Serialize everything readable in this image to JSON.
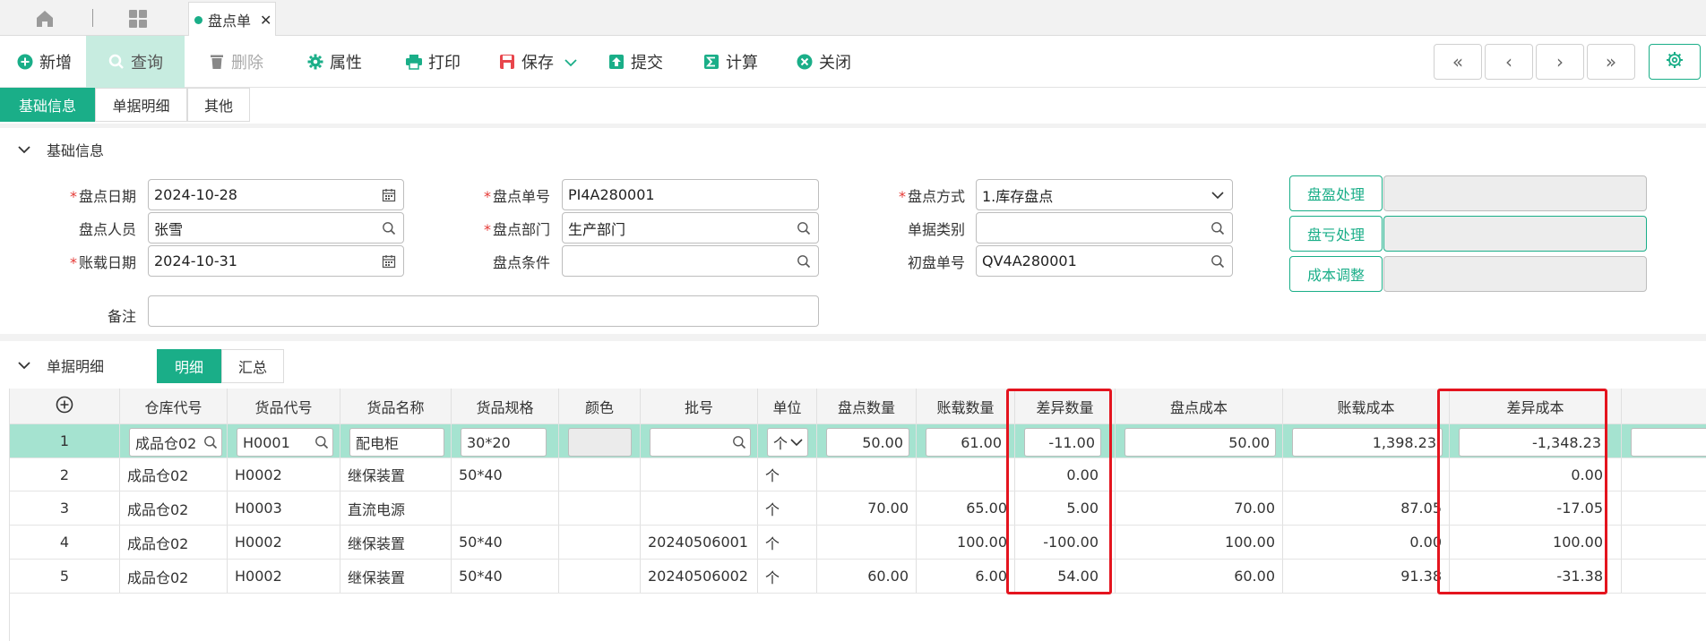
{
  "tabstrip": {
    "tab_label": "盘点单"
  },
  "toolbar": {
    "new": "新增",
    "query": "查询",
    "delete": "删除",
    "props": "属性",
    "print": "打印",
    "save": "保存",
    "submit": "提交",
    "calc": "计算",
    "close": "关闭",
    "nav": [
      "«",
      "‹",
      "›",
      "»"
    ]
  },
  "section_tabs": [
    "基础信息",
    "单据明细",
    "其他"
  ],
  "basic_section_title": "基础信息",
  "form": {
    "date_label": "盘点日期",
    "date": "2024-10-28",
    "no_label": "盘点单号",
    "no": "PI4A280001",
    "method_label": "盘点方式",
    "method": "1.库存盘点",
    "person_label": "盘点人员",
    "person": "张雪",
    "dept_label": "盘点部门",
    "dept": "生产部门",
    "doctype_label": "单据类别",
    "doctype": "",
    "acct_date_label": "账载日期",
    "acct_date": "2024-10-31",
    "cond_label": "盘点条件",
    "cond": "",
    "init_no_label": "初盘单号",
    "init_no": "QV4A280001",
    "remark_label": "备注",
    "remark": "",
    "btn_profit": "盘盈处理",
    "btn_loss": "盘亏处理",
    "btn_cost": "成本调整"
  },
  "detail_section_title": "单据明细",
  "detail_tabs": [
    "明细",
    "汇总"
  ],
  "table": {
    "headers": [
      "仓库代号",
      "货品代号",
      "货品名称",
      "货品规格",
      "颜色",
      "批号",
      "单位",
      "盘点数量",
      "账载数量",
      "差异数量",
      "盘点成本",
      "账载成本",
      "差异成本"
    ],
    "rows": [
      [
        "1",
        "成品仓02",
        "H0001",
        "配电柜",
        "30*20",
        "",
        "",
        "个",
        "50.00",
        "61.00",
        "-11.00",
        "50.00",
        "1,398.23",
        "-1,348.23"
      ],
      [
        "2",
        "成品仓02",
        "H0002",
        "继保装置",
        "50*40",
        "",
        "",
        "个",
        "",
        "",
        "0.00",
        "",
        "",
        "0.00"
      ],
      [
        "3",
        "成品仓02",
        "H0003",
        "直流电源",
        "",
        "",
        "",
        "个",
        "70.00",
        "65.00",
        "5.00",
        "70.00",
        "87.05",
        "-17.05"
      ],
      [
        "4",
        "成品仓02",
        "H0002",
        "继保装置",
        "50*40",
        "",
        "20240506001",
        "个",
        "",
        "100.00",
        "-100.00",
        "100.00",
        "0.00",
        "100.00"
      ],
      [
        "5",
        "成品仓02",
        "H0002",
        "继保装置",
        "50*40",
        "",
        "20240506002",
        "个",
        "60.00",
        "6.00",
        "54.00",
        "60.00",
        "91.38",
        "-31.38"
      ]
    ]
  },
  "colors": {
    "accent": "#1aae88",
    "highlight": "#e4141e",
    "selected_row": "#a5e3d0"
  }
}
